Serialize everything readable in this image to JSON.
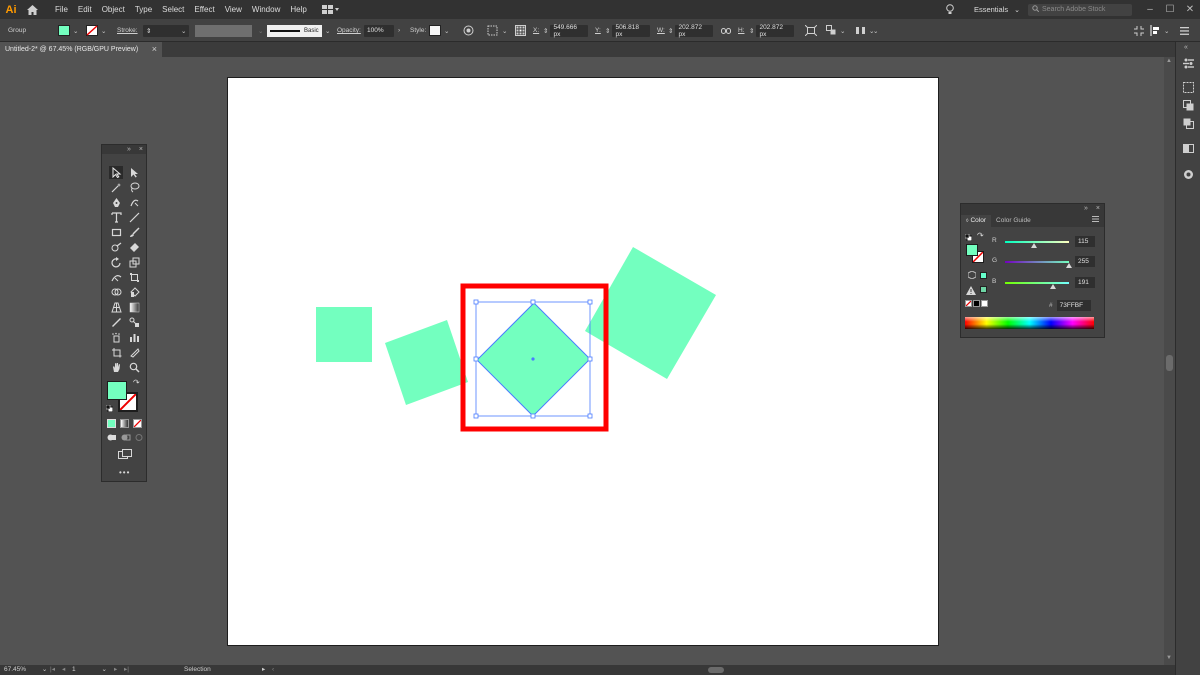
{
  "app": {
    "logo": "Ai"
  },
  "menu": [
    "File",
    "Edit",
    "Object",
    "Type",
    "Select",
    "Effect",
    "View",
    "Window",
    "Help"
  ],
  "menubar_right": {
    "workspace": "Essentials",
    "search_placeholder": "Search Adobe Stock"
  },
  "control": {
    "selection_type": "Group",
    "stroke_label": "Stroke:",
    "brush_label": "Basic",
    "opacity_label": "Opacity:",
    "opacity_value": "100%",
    "style_label": "Style:",
    "x_label": "X:",
    "x_value": "549.666 px",
    "y_label": "Y:",
    "y_value": "506.818 px",
    "w_label": "W:",
    "w_value": "202.872 px",
    "h_label": "H:",
    "h_value": "202.872 px"
  },
  "document": {
    "tab_title": "Untitled-2* @ 67.45% (RGB/GPU Preview)"
  },
  "colors": {
    "fill": "#73FFBF",
    "highlight": "#ff0000",
    "selection": "#4a7cff"
  },
  "color_panel": {
    "tabs": [
      "Color",
      "Color Guide"
    ],
    "r_label": "R",
    "r_value": "115",
    "r_fraction": 0.451,
    "g_label": "G",
    "g_value": "255",
    "g_fraction": 1.0,
    "b_label": "B",
    "b_value": "191",
    "b_fraction": 0.749,
    "hex_label": "#",
    "hex_value": "73FFBF"
  },
  "status": {
    "zoom": "67.45%",
    "page": "1",
    "tool": "Selection"
  }
}
